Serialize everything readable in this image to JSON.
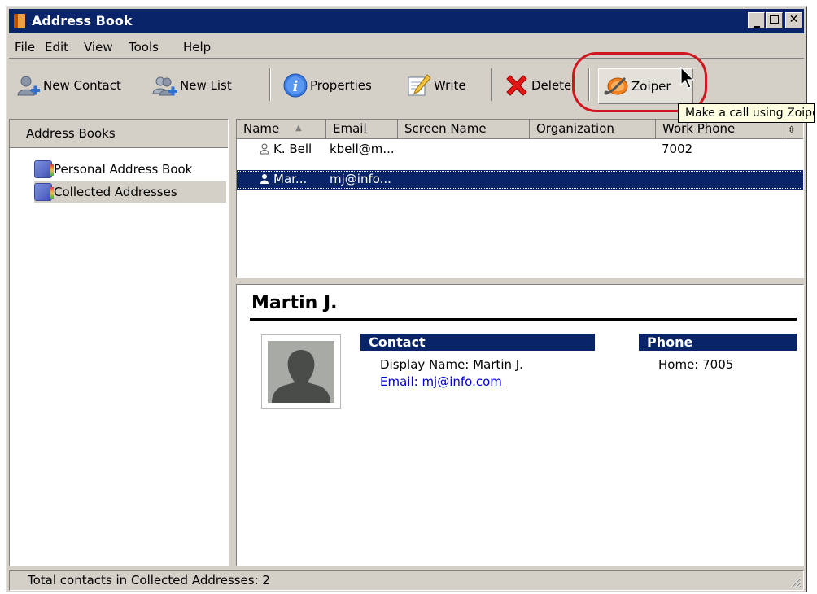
{
  "window": {
    "title": "Address Book"
  },
  "menu": {
    "file": "File",
    "edit": "Edit",
    "view": "View",
    "tools": "Tools",
    "help": "Help"
  },
  "toolbar": {
    "new_contact": "New Contact",
    "new_list": "New List",
    "properties": "Properties",
    "write": "Write",
    "delete": "Delete",
    "zoiper": "Zoiper"
  },
  "tooltip": "Make a call using Zoiper",
  "sidebar": {
    "header": "Address Books",
    "items": [
      {
        "label": "Personal Address Book"
      },
      {
        "label": "Collected Addresses"
      }
    ]
  },
  "list": {
    "columns": [
      "Name",
      "Email",
      "Screen Name",
      "Organization",
      "Work Phone"
    ],
    "rows": [
      {
        "name": "K. Bell",
        "email": "kbell@m...",
        "work_phone": "7002"
      },
      {
        "name": "Mar...",
        "email": "mj@info...",
        "work_phone": ""
      }
    ]
  },
  "contact": {
    "name": "Martin J.",
    "contact_header": "Contact",
    "display_name": "Display Name: Martin J.",
    "email": "Email: mj@info.com",
    "phone_header": "Phone",
    "home_phone": "Home: 7005"
  },
  "status": {
    "text": "Total contacts in Collected Addresses: 2"
  },
  "colors": {
    "titlebar": "#0a246a",
    "selection": "#0a246a",
    "highlight_ring": "#d0161e",
    "tooltip_bg": "#ffffe1"
  }
}
